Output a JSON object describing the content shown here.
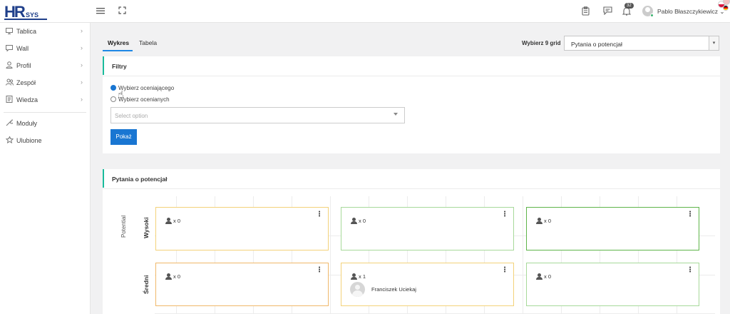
{
  "app": {
    "logo_main": "HR",
    "logo_sub": "SYS"
  },
  "header": {
    "notifications_count": "32",
    "user_name": "Pablo Błaszczykiewicz"
  },
  "sidebar": {
    "items": [
      {
        "label": "Tablica",
        "icon": "monitor-icon",
        "has_children": true
      },
      {
        "label": "Wall",
        "icon": "chat-icon",
        "has_children": true
      },
      {
        "label": "Profil",
        "icon": "user-icon",
        "has_children": true
      },
      {
        "label": "Zespół",
        "icon": "team-icon",
        "has_children": true
      },
      {
        "label": "Wiedza",
        "icon": "book-icon",
        "has_children": true
      },
      {
        "label": "Moduły",
        "icon": "wrench-icon",
        "has_children": false
      },
      {
        "label": "Ulubione",
        "icon": "star-icon",
        "has_children": false
      }
    ]
  },
  "tabs": [
    {
      "label": "Wykres",
      "active": true
    },
    {
      "label": "Tabela",
      "active": false
    }
  ],
  "grid_selector": {
    "label": "Wybierz 9 grid",
    "value": "Pytania o potencjał"
  },
  "filters": {
    "title": "Filtry",
    "radio_evaluator": "Wybierz oceniającego",
    "radio_evaluated": "Wybierz ocenianych",
    "selected": "radio_evaluator",
    "select_placeholder": "Select option",
    "submit_label": "Pokaż"
  },
  "grid_panel": {
    "title": "Pytania o potencjał",
    "axis_y": "Potential",
    "rows": [
      {
        "label": "Wysoki",
        "cells": [
          {
            "count": "x 0",
            "border": "#f3d27a",
            "members": []
          },
          {
            "count": "x 0",
            "border": "#a7d99a",
            "members": []
          },
          {
            "count": "x 0",
            "border": "#5fb54a",
            "members": []
          }
        ]
      },
      {
        "label": "Średni",
        "cells": [
          {
            "count": "x 0",
            "border": "#f0b86a",
            "members": []
          },
          {
            "count": "x 1",
            "border": "#f3d27a",
            "members": [
              "Franciszek Uciekaj"
            ]
          },
          {
            "count": "x 0",
            "border": "#a7d99a",
            "members": []
          }
        ]
      }
    ]
  },
  "colors": {
    "primary": "#1976d2",
    "accent": "#1abc9c"
  }
}
